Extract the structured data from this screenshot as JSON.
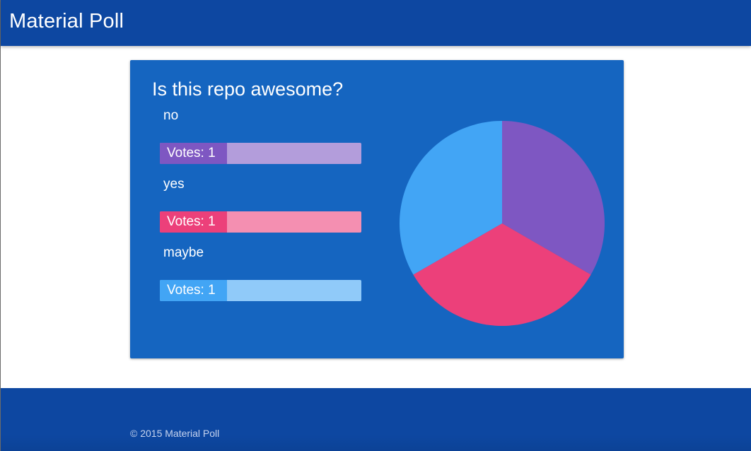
{
  "app": {
    "title": "Material Poll"
  },
  "poll": {
    "question": "Is this repo awesome?",
    "options": [
      {
        "label": "no",
        "votes_text": "Votes: 1",
        "votes": 1,
        "color": "#7e57c2",
        "track_color": "#b39ddb"
      },
      {
        "label": "yes",
        "votes_text": "Votes: 1",
        "votes": 1,
        "color": "#ec407a",
        "track_color": "#f48fb1"
      },
      {
        "label": "maybe",
        "votes_text": "Votes: 1",
        "votes": 1,
        "color": "#42a5f5",
        "track_color": "#90caf9"
      }
    ]
  },
  "chart_data": {
    "type": "pie",
    "categories": [
      "no",
      "yes",
      "maybe"
    ],
    "values": [
      1,
      1,
      1
    ],
    "colors": [
      "#7e57c2",
      "#ec407a",
      "#42a5f5"
    ]
  },
  "footer": {
    "copyright": "© 2015 Material Poll"
  },
  "colors": {
    "app_bar": "#0d47a1",
    "card": "#1565c0",
    "text": "#ffffff"
  }
}
